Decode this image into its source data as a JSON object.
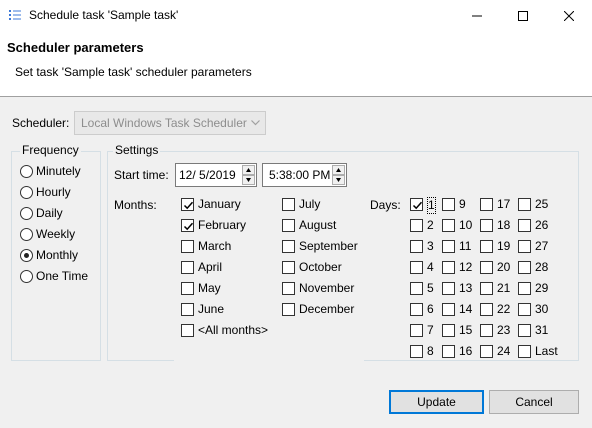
{
  "window": {
    "title": "Schedule task 'Sample task'",
    "icon": "list-bullets-icon",
    "controls": [
      "minimize-icon",
      "maximize-icon",
      "close-icon"
    ]
  },
  "header": {
    "title": "Scheduler parameters",
    "description": "Set task 'Sample task' scheduler parameters"
  },
  "scheduler": {
    "label": "Scheduler:",
    "value": "Local Windows Task Scheduler",
    "enabled": false
  },
  "frequency": {
    "legend": "Frequency",
    "options": [
      {
        "label": "Minutely",
        "selected": false
      },
      {
        "label": "Hourly",
        "selected": false
      },
      {
        "label": "Daily",
        "selected": false
      },
      {
        "label": "Weekly",
        "selected": false
      },
      {
        "label": "Monthly",
        "selected": true
      },
      {
        "label": "One Time",
        "selected": false
      }
    ]
  },
  "settings": {
    "legend": "Settings",
    "start_time_label": "Start time:",
    "start_date": "12/  5/2019",
    "start_time": "5:38:00 PM",
    "months_label": "Months:",
    "months": [
      {
        "label": "January",
        "checked": true
      },
      {
        "label": "February",
        "checked": true
      },
      {
        "label": "March",
        "checked": false
      },
      {
        "label": "April",
        "checked": false
      },
      {
        "label": "May",
        "checked": false
      },
      {
        "label": "June",
        "checked": false
      },
      {
        "label": "July",
        "checked": false
      },
      {
        "label": "August",
        "checked": false
      },
      {
        "label": "September",
        "checked": false
      },
      {
        "label": "October",
        "checked": false
      },
      {
        "label": "November",
        "checked": false
      },
      {
        "label": "December",
        "checked": false
      }
    ],
    "all_months": {
      "label": "<All months>",
      "checked": false
    },
    "days_label": "Days:",
    "days": [
      {
        "label": "1",
        "checked": true
      },
      {
        "label": "2",
        "checked": false
      },
      {
        "label": "3",
        "checked": false
      },
      {
        "label": "4",
        "checked": false
      },
      {
        "label": "5",
        "checked": false
      },
      {
        "label": "6",
        "checked": false
      },
      {
        "label": "7",
        "checked": false
      },
      {
        "label": "8",
        "checked": false
      },
      {
        "label": "9",
        "checked": false
      },
      {
        "label": "10",
        "checked": false
      },
      {
        "label": "11",
        "checked": false
      },
      {
        "label": "12",
        "checked": false
      },
      {
        "label": "13",
        "checked": false
      },
      {
        "label": "14",
        "checked": false
      },
      {
        "label": "15",
        "checked": false
      },
      {
        "label": "16",
        "checked": false
      },
      {
        "label": "17",
        "checked": false
      },
      {
        "label": "18",
        "checked": false
      },
      {
        "label": "19",
        "checked": false
      },
      {
        "label": "20",
        "checked": false
      },
      {
        "label": "21",
        "checked": false
      },
      {
        "label": "22",
        "checked": false
      },
      {
        "label": "23",
        "checked": false
      },
      {
        "label": "24",
        "checked": false
      },
      {
        "label": "25",
        "checked": false
      },
      {
        "label": "26",
        "checked": false
      },
      {
        "label": "27",
        "checked": false
      },
      {
        "label": "28",
        "checked": false
      },
      {
        "label": "29",
        "checked": false
      },
      {
        "label": "30",
        "checked": false
      },
      {
        "label": "31",
        "checked": false
      },
      {
        "label": "Last",
        "checked": false
      }
    ]
  },
  "buttons": {
    "update": "Update",
    "cancel": "Cancel"
  },
  "colors": {
    "default_button_border": "#0078d7",
    "disabled_text": "#8d8d8d"
  }
}
